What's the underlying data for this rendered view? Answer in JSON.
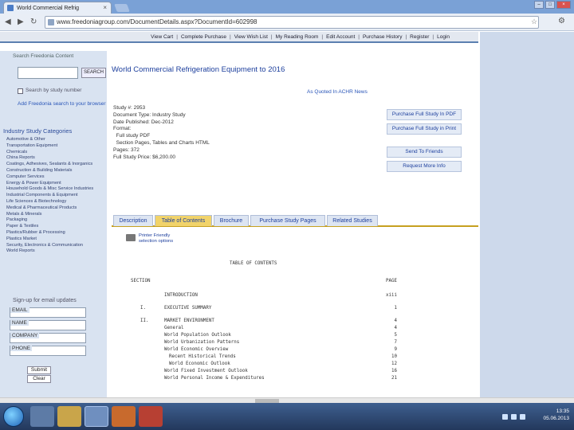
{
  "browser": {
    "tab_title": "World Commercial Refrig",
    "url": "www.freedoniagroup.com/DocumentDetails.aspx?DocumentId=602998"
  },
  "topnav": [
    "View Cart",
    "Complete Purchase",
    "View Wish List",
    "My Reading Room",
    "Edit Account",
    "Purchase History",
    "Register",
    "Login"
  ],
  "sidebar": {
    "search_title": "Search Freedonia Content",
    "search_button": "SEARCH",
    "study_number_label": "Search by study number",
    "add_search_link": "Add Freedonia search to your browser",
    "categories_title": "Industry Study Categories",
    "categories": [
      "Automotive & Other",
      "Transportation Equipment",
      "Chemicals",
      "China Reports",
      "Coatings, Adhesives, Sealants & Inorganics",
      "Construction & Building Materials",
      "Computer Services",
      "Energy & Power Equipment",
      "Household Goods & Misc Service Industries",
      "Industrial Components & Equipment",
      "Life Sciences & Biotechnology",
      "Medical & Pharmaceutical Products",
      "Metals & Minerals",
      "Packaging",
      "Paper & Textiles",
      "Plastics/Rubber & Processing",
      "Plastics Market",
      "Security, Electronics & Communication",
      "World Reports"
    ],
    "signup_title": "Sign-up for email updates",
    "fields": [
      "EMAIL",
      "NAME",
      "COMPANY",
      "PHONE"
    ],
    "submit": "Submit",
    "clear": "Clear"
  },
  "main": {
    "title": "World Commercial Refrigeration Equipment to 2016",
    "as_quoted": "As Quoted In ACHR News",
    "info": [
      "Study #: 2953",
      "Document Type: Industry Study",
      "Date Published: Dec-2012",
      "Format:",
      "  Full study PDF",
      "  Section Pages, Tables and Charts HTML",
      "Pages: 372",
      "Full Study Price: $6,200.00"
    ],
    "actions": [
      "Purchase Full Study In PDF",
      "Purchase Full Study in Print",
      "Send To Friends",
      "Request More Info"
    ],
    "tabs": [
      "Description",
      "Table of Contents",
      "Brochure",
      "Purchase Study Pages",
      "Related Studies"
    ],
    "printer_label_1": "Printer Friendly",
    "printer_label_2": "selection options"
  },
  "toc": {
    "heading": "TABLE OF CONTENTS",
    "section_label": "SECTION",
    "page_label": "PAGE",
    "rows": [
      {
        "num": "",
        "text": "INTRODUCTION",
        "page": "xiii"
      },
      {
        "num": "I.",
        "text": "EXECUTIVE SUMMARY",
        "page": "1"
      },
      {
        "num": "II.",
        "text": "MARKET ENVIRONMENT",
        "page": "4"
      },
      {
        "num": "",
        "text": "General",
        "page": "4"
      },
      {
        "num": "",
        "text": "World Population Outlook",
        "page": "5"
      },
      {
        "num": "",
        "text": "World Urbanization Patterns",
        "page": "7"
      },
      {
        "num": "",
        "text": "World Economic Overview",
        "page": "9"
      },
      {
        "num": "",
        "text": "Recent Historical Trends",
        "page": "10"
      },
      {
        "num": "",
        "text": "World Economic Outlook",
        "page": "12"
      },
      {
        "num": "",
        "text": "World Fixed Investment Outlook",
        "page": "16"
      },
      {
        "num": "",
        "text": "World Personal Income & Expenditures",
        "page": "21"
      }
    ]
  },
  "taskbar": {
    "time": "13:35",
    "date": "05.06.2013"
  }
}
